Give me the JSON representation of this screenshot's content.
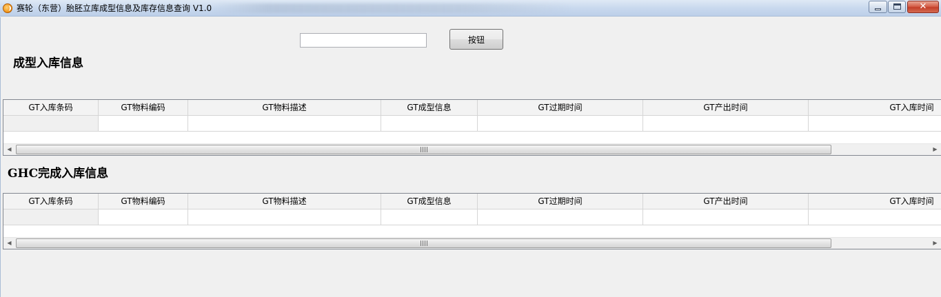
{
  "window": {
    "title": "赛轮（东营）胎胚立库成型信息及库存信息查询 V1.0",
    "close_glyph": "✕"
  },
  "toolbar": {
    "search_value": "",
    "button_label": "按钮"
  },
  "sections": [
    {
      "title": "成型入库信息",
      "columns": [
        "GT入库条码",
        "GT物料编码",
        "GT物料描述",
        "GT成型信息",
        "GT过期时间",
        "GT产出时间",
        "GT入库时间"
      ]
    },
    {
      "title": "GHC完成入库信息",
      "columns": [
        "GT入库条码",
        "GT物料编码",
        "GT物料描述",
        "GT成型信息",
        "GT过期时间",
        "GT产出时间",
        "GT入库时间"
      ]
    }
  ],
  "scrollbar": {
    "left_arrow": "◀",
    "right_arrow": "▶"
  }
}
